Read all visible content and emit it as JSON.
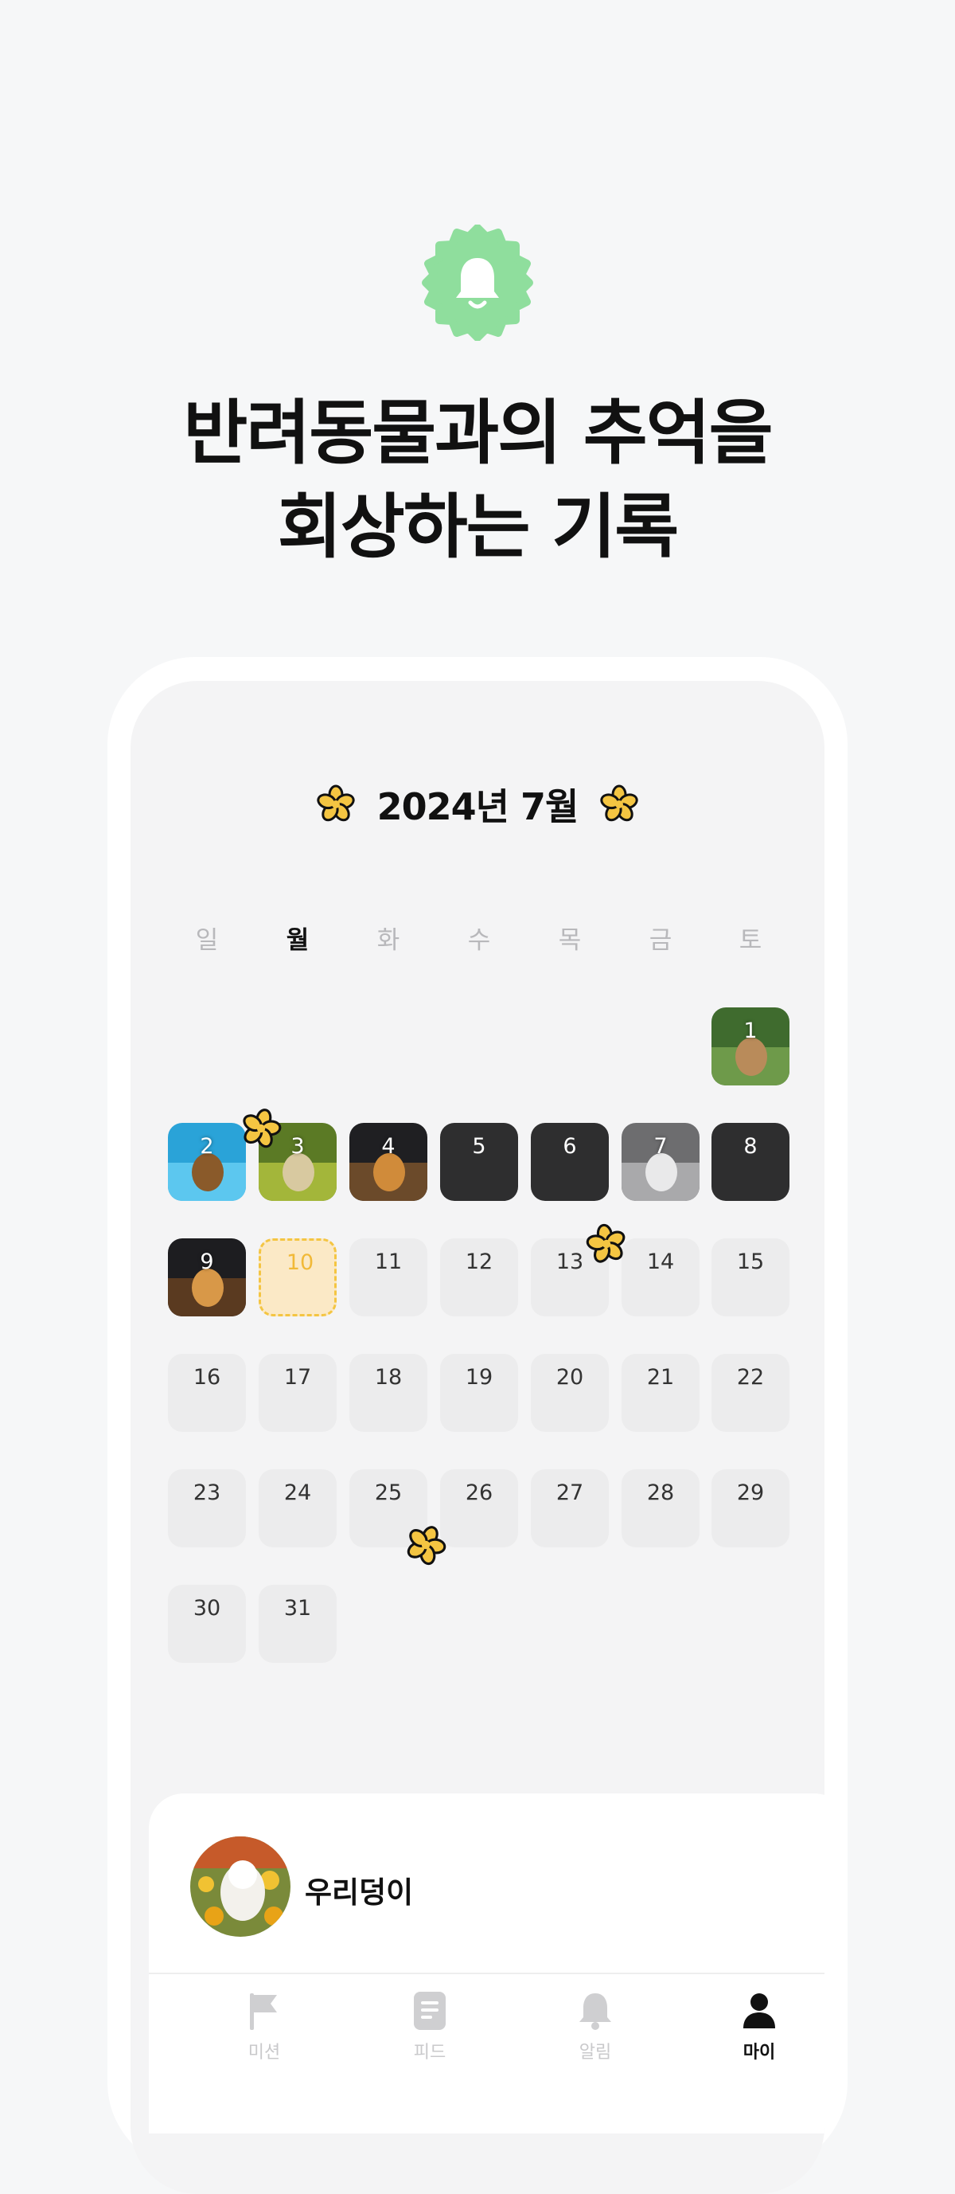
{
  "header": {
    "badge_icon": "bell-icon",
    "badge_color": "#8fde9d",
    "headline_line1": "반려동물과의 추억을",
    "headline_line2": "회상하는 기록"
  },
  "calendar": {
    "month_title": "2024년 7월",
    "accent_color": "#f4c542",
    "weekdays": [
      "일",
      "월",
      "화",
      "수",
      "목",
      "금",
      "토"
    ],
    "active_weekday": "월",
    "days": [
      {
        "n": "1",
        "state": "photo"
      },
      {
        "n": "2",
        "state": "photo"
      },
      {
        "n": "3",
        "state": "photo"
      },
      {
        "n": "4",
        "state": "photo"
      },
      {
        "n": "5",
        "state": "recorded"
      },
      {
        "n": "6",
        "state": "recorded"
      },
      {
        "n": "7",
        "state": "photo"
      },
      {
        "n": "8",
        "state": "recorded"
      },
      {
        "n": "9",
        "state": "photo"
      },
      {
        "n": "10",
        "state": "today"
      },
      {
        "n": "11",
        "state": "empty"
      },
      {
        "n": "12",
        "state": "empty"
      },
      {
        "n": "13",
        "state": "empty"
      },
      {
        "n": "14",
        "state": "empty"
      },
      {
        "n": "15",
        "state": "empty"
      },
      {
        "n": "16",
        "state": "empty"
      },
      {
        "n": "17",
        "state": "empty"
      },
      {
        "n": "18",
        "state": "empty"
      },
      {
        "n": "19",
        "state": "empty"
      },
      {
        "n": "20",
        "state": "empty"
      },
      {
        "n": "21",
        "state": "empty"
      },
      {
        "n": "22",
        "state": "empty"
      },
      {
        "n": "23",
        "state": "empty"
      },
      {
        "n": "24",
        "state": "empty"
      },
      {
        "n": "25",
        "state": "empty"
      },
      {
        "n": "26",
        "state": "empty"
      },
      {
        "n": "27",
        "state": "empty"
      },
      {
        "n": "28",
        "state": "empty"
      },
      {
        "n": "29",
        "state": "empty"
      },
      {
        "n": "30",
        "state": "empty"
      },
      {
        "n": "31",
        "state": "empty"
      }
    ]
  },
  "profile": {
    "pet_name": "우리덩이",
    "avatar_icon": "pet-avatar"
  },
  "tabbar": {
    "tabs": [
      {
        "label": "미션",
        "icon": "flag-icon"
      },
      {
        "label": "피드",
        "icon": "document-icon"
      },
      {
        "label": "알림",
        "icon": "bell-icon"
      },
      {
        "label": "마이",
        "icon": "person-icon"
      }
    ],
    "active_tab": "마이"
  }
}
